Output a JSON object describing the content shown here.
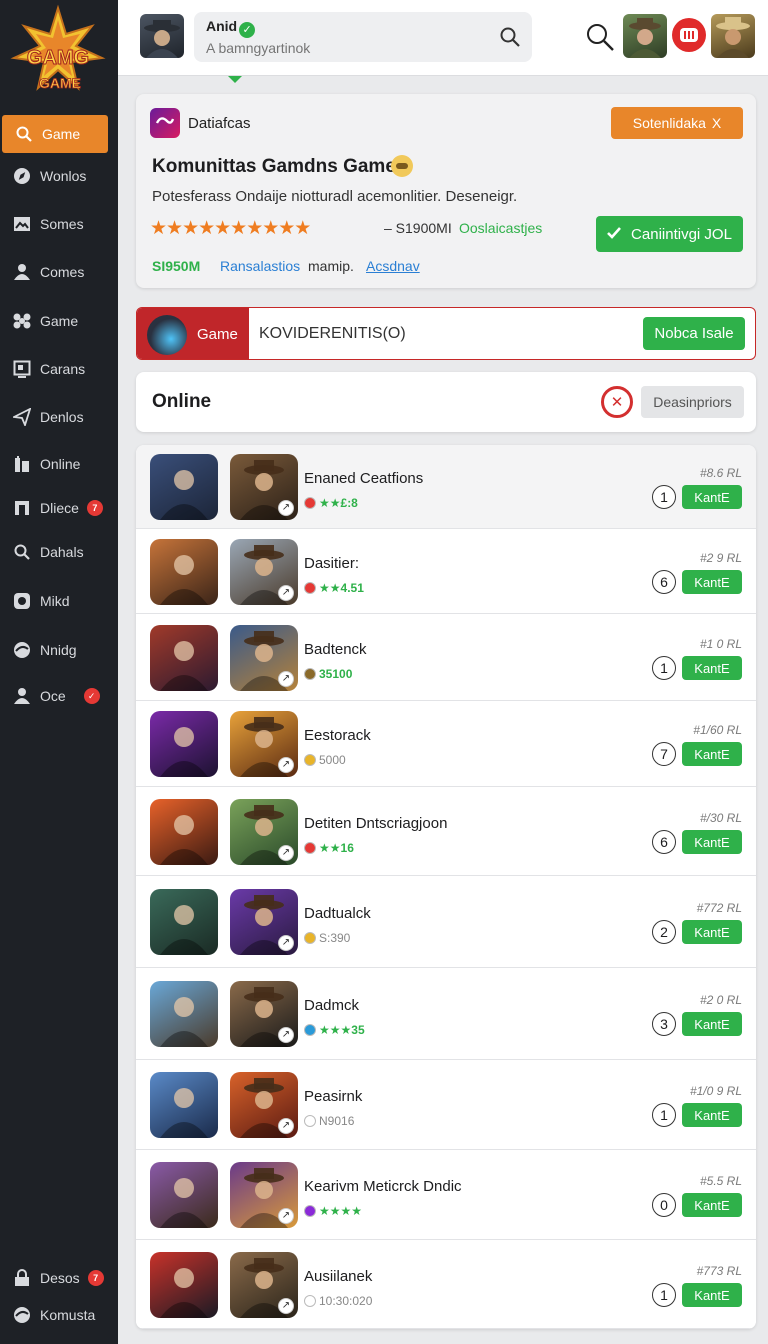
{
  "logo": {
    "line1": "GAMG",
    "line2": "GAME"
  },
  "sidebar": {
    "items": [
      {
        "label": "Game",
        "icon": "search-icon",
        "active": true
      },
      {
        "label": "Wonlos",
        "icon": "compass-icon"
      },
      {
        "label": "Somes",
        "icon": "image-icon"
      },
      {
        "label": "Comes",
        "icon": "user-icon"
      },
      {
        "label": "Game",
        "icon": "gamepad-icon"
      },
      {
        "label": "Carans",
        "icon": "screen-icon"
      },
      {
        "label": "Denlos",
        "icon": "send-icon"
      },
      {
        "label": "Online",
        "icon": "building-icon"
      },
      {
        "label": "Dliece",
        "icon": "square-icon",
        "badge": "7"
      },
      {
        "label": "Dahals",
        "icon": "search-icon"
      },
      {
        "label": "Mikd",
        "icon": "disc-icon"
      },
      {
        "label": "Nnidg",
        "icon": "globe-icon"
      },
      {
        "label": "Oce",
        "icon": "user-icon",
        "badge": "✓"
      }
    ],
    "bottom": [
      {
        "label": "Desos",
        "icon": "lock-icon",
        "badge": "7"
      },
      {
        "label": "Komusta",
        "icon": "globe-icon"
      }
    ]
  },
  "topbar": {
    "username": "Anid",
    "search_placeholder": "A bamngyartinok"
  },
  "featured": {
    "source": "Datiafcas",
    "action_label": "Sotenlidaka",
    "action_close": "X",
    "title": "Komunittas Gamdns Game",
    "description": "Potesferass Ondaije niotturadl acemonlitier. Deseneigr.",
    "rating_stars": 10,
    "price_text": "– S1900MI",
    "category_text": "Ooslaicastjes",
    "primary_label": "Caniintivgi JOL",
    "amount": "SI950M",
    "link1": "Ransalastios",
    "link1_suffix": "mamip.",
    "link2": "Acsdnav",
    "colors": {
      "accent": "#e8862a",
      "green": "#2fb14a",
      "link": "#2a7fd4"
    }
  },
  "gamebar": {
    "label": "Game",
    "input_value": "KOVIDERENITIS(O)",
    "button_label": "Nobca Isale"
  },
  "online": {
    "title": "Online",
    "filter_label": "Deasinpriors"
  },
  "games": [
    {
      "title": "Enaned Ceatfions",
      "meta": "★★£:8",
      "meta_gray": false,
      "price": "#8.6 RL",
      "rank": "1",
      "button": "KantE"
    },
    {
      "title": "Dasitier:",
      "meta": "★★4.51",
      "meta_gray": false,
      "price": "#2 9 RL",
      "rank": "6",
      "button": "KantE"
    },
    {
      "title": "Badtenck",
      "meta": "35100",
      "meta_gray": false,
      "price": "#1 0 RL",
      "rank": "1",
      "button": "KantE"
    },
    {
      "title": "Eestorack",
      "meta": "5000",
      "meta_gray": true,
      "price": "#1/60 RL",
      "rank": "7",
      "button": "KantE"
    },
    {
      "title": "Detiten Dntscriagjoon",
      "meta": "★★16",
      "meta_gray": false,
      "price": "#/30 RL",
      "rank": "6",
      "button": "KantE"
    },
    {
      "title": "Dadtualck",
      "meta": "S:390",
      "meta_gray": true,
      "price": "#772 RL",
      "rank": "2",
      "button": "KantE"
    },
    {
      "title": "Dadmck",
      "meta": "★★★35",
      "meta_gray": false,
      "price": "#2 0 RL",
      "rank": "3",
      "button": "KantE"
    },
    {
      "title": "Peasirnk",
      "meta": "N9016",
      "meta_gray": true,
      "price": "#1/0 9 RL",
      "rank": "1",
      "button": "KantE"
    },
    {
      "title": "Kearivm Meticrck Dndic",
      "meta": "★★★★",
      "meta_gray": false,
      "price": "#5.5 RL",
      "rank": "0",
      "button": "KantE"
    },
    {
      "title": "Ausiilanek",
      "meta": "10:30:020",
      "meta_gray": true,
      "price": "#773 RL",
      "rank": "1",
      "button": "KantE"
    }
  ]
}
